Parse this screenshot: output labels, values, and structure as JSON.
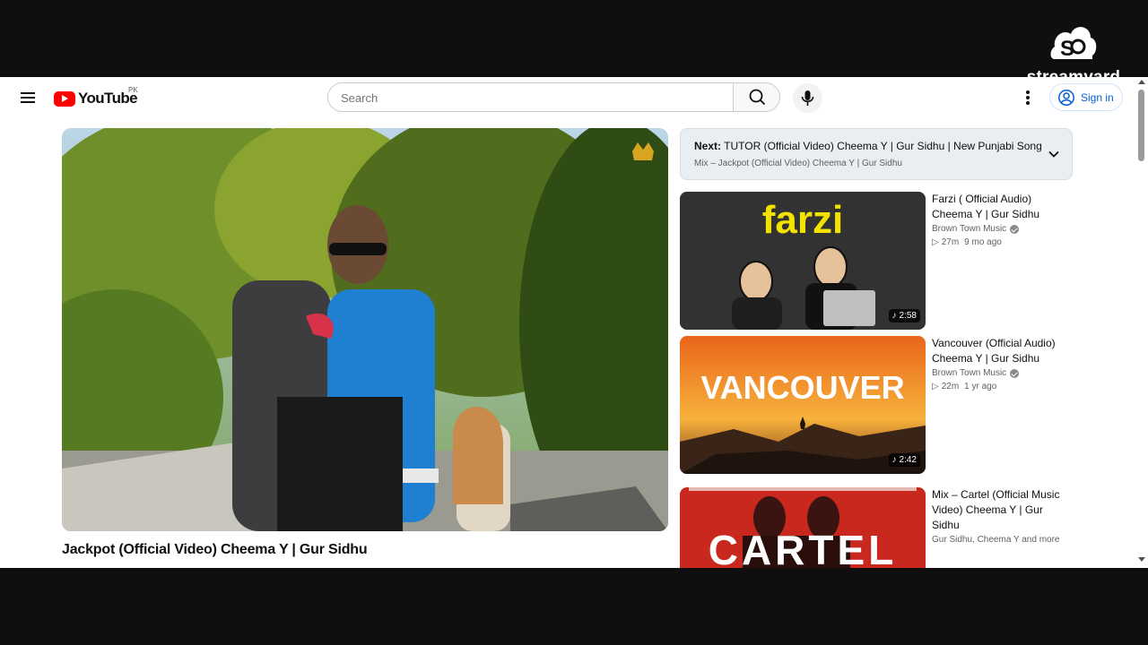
{
  "overlay": {
    "brand": "streamyard",
    "icon": "streamyard-logo-icon"
  },
  "masthead": {
    "logo_text": "YouTube",
    "country_code": "PK",
    "search_placeholder": "Search",
    "signin_label": "Sign in",
    "icons": [
      "menu-icon",
      "search-icon",
      "mic-icon",
      "more-vert-icon",
      "account-icon"
    ]
  },
  "video": {
    "title": "Jackpot (Official Video) Cheema Y | Gur Sidhu"
  },
  "up_next": {
    "prefix": "Next:",
    "next_title": "TUTOR (Official Video) Cheema Y | Gur Sidhu | New Punjabi Song",
    "mix_label": "Mix – Jackpot (Official Video) Cheema Y | Gur Sidhu"
  },
  "recommendations": [
    {
      "title": "Farzi ( Official Audio) Cheema Y | Gur Sidhu",
      "channel": "Brown Town Music",
      "verified": true,
      "plays": "27m",
      "age": "9 mo ago",
      "duration": "2:58",
      "thumb_text": "farzi",
      "thumb_color": "#2b2b2b"
    },
    {
      "title": "Vancouver (Official Audio) Cheema Y | Gur Sidhu",
      "channel": "Brown Town Music",
      "verified": true,
      "plays": "22m",
      "age": "1 yr ago",
      "duration": "2:42",
      "thumb_text": "VANCOUVER",
      "thumb_color": "#e07a1f"
    },
    {
      "title": "Mix – Cartel (Official Music Video) Cheema Y | Gur Sidhu",
      "channel": "Gur Sidhu, Cheema Y and more",
      "verified": false,
      "thumb_text": "CARTEL",
      "thumb_color": "#c8281e"
    }
  ],
  "colors": {
    "accent": "#ff0000",
    "link": "#065fd4"
  }
}
